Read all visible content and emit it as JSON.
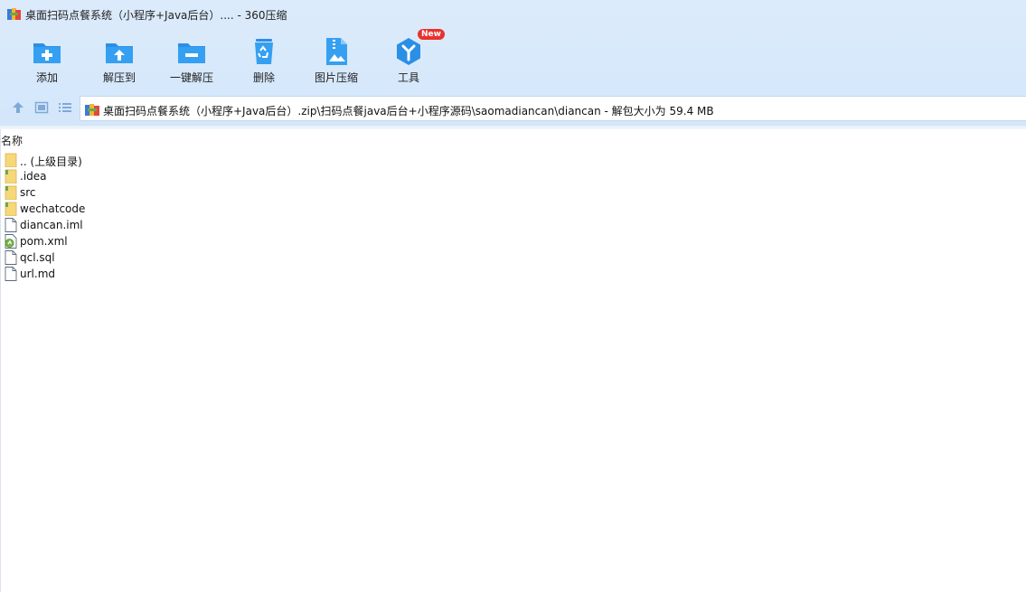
{
  "window": {
    "title": "桌面扫码点餐系统（小程序+Java后台）.... - 360压缩"
  },
  "toolbar": {
    "items": [
      {
        "label": "添加",
        "icon": "add-folder-icon"
      },
      {
        "label": "解压到",
        "icon": "extract-to-icon"
      },
      {
        "label": "一键解压",
        "icon": "one-click-extract-icon"
      },
      {
        "label": "删除",
        "icon": "recycle-bin-icon"
      },
      {
        "label": "图片压缩",
        "icon": "image-compress-icon"
      },
      {
        "label": "工具",
        "icon": "tools-icon",
        "badge": "New"
      }
    ]
  },
  "nav": {
    "up_icon": "up-arrow-icon",
    "view_icon": "view-thumbnail-icon",
    "list_icon": "view-list-icon"
  },
  "address": {
    "path": "桌面扫码点餐系统（小程序+Java后台）.zip\\扫码点餐java后台+小程序源码\\saomadiancan\\diancan - 解包大小为 59.4 MB"
  },
  "list": {
    "column_name": "名称",
    "files": [
      {
        "name": ".. (上级目录)",
        "type": "parent-folder-icon"
      },
      {
        "name": ".idea",
        "type": "folder-icon"
      },
      {
        "name": "src",
        "type": "folder-icon"
      },
      {
        "name": "wechatcode",
        "type": "folder-icon"
      },
      {
        "name": "diancan.iml",
        "type": "file-icon"
      },
      {
        "name": "pom.xml",
        "type": "xml-file-icon"
      },
      {
        "name": "qcl.sql",
        "type": "file-icon"
      },
      {
        "name": "url.md",
        "type": "file-icon"
      }
    ]
  },
  "colors": {
    "accent": "#2b8fe6",
    "header_bg": "#d6e8fb",
    "badge": "#e8322e"
  }
}
